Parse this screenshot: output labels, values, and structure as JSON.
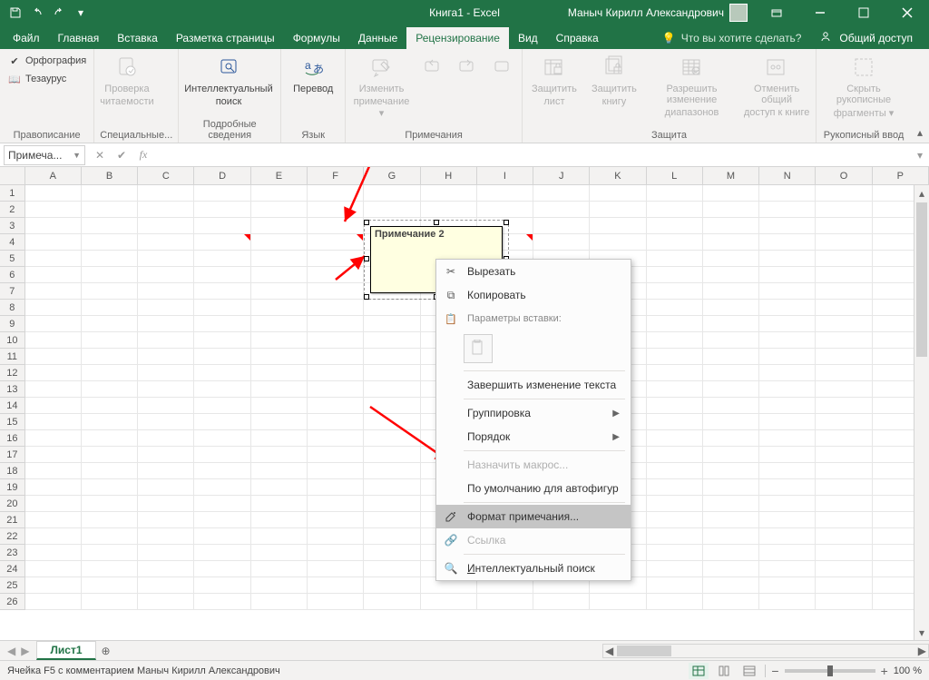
{
  "titlebar": {
    "title": "Книга1  -  Excel",
    "user": "Маныч Кирилл Александрович"
  },
  "tabs": {
    "file": "Файл",
    "home": "Главная",
    "insert": "Вставка",
    "page_layout": "Разметка страницы",
    "formulas": "Формулы",
    "data": "Данные",
    "review": "Рецензирование",
    "view": "Вид",
    "help": "Справка",
    "tellme": "Что вы хотите сделать?",
    "share": "Общий доступ"
  },
  "ribbon": {
    "proofing": {
      "spelling": "Орфография",
      "thesaurus": "Тезаурус",
      "label": "Правописание"
    },
    "accessibility": {
      "btn1": "Проверка",
      "btn2": "читаемости",
      "label": "Специальные..."
    },
    "insights": {
      "btn1": "Интеллектуальный",
      "btn2": "поиск",
      "label": "Подробные сведения"
    },
    "language": {
      "btn": "Перевод",
      "label": "Язык"
    },
    "comments": {
      "edit1": "Изменить",
      "edit2": "примечание",
      "label": "Примечания"
    },
    "protect": {
      "sheet1": "Защитить",
      "sheet2": "лист",
      "book1": "Защитить",
      "book2": "книгу",
      "ranges1": "Разрешить изменение",
      "ranges2": "диапазонов",
      "unshare1": "Отменить общий",
      "unshare2": "доступ к книге",
      "label": "Защита"
    },
    "ink": {
      "hide1": "Скрыть рукописные",
      "hide2": "фрагменты",
      "label": "Рукописный ввод"
    }
  },
  "namebox": {
    "value": "Примеча..."
  },
  "columns": [
    "A",
    "B",
    "C",
    "D",
    "E",
    "F",
    "G",
    "H",
    "I",
    "J",
    "K",
    "L",
    "M",
    "N",
    "O",
    "P"
  ],
  "rows": [
    1,
    2,
    3,
    4,
    5,
    6,
    7,
    8,
    9,
    10,
    11,
    12,
    13,
    14,
    15,
    16,
    17,
    18,
    19,
    20,
    21,
    22,
    23,
    24,
    25,
    26
  ],
  "comment_cells": [
    "D4",
    "F4",
    "I4"
  ],
  "comment": {
    "text": "Примечание 2"
  },
  "context_menu": {
    "cut": "Вырезать",
    "copy": "Копировать",
    "paste_header": "Параметры вставки:",
    "end_edit": "Завершить изменение текста",
    "group": "Группировка",
    "order": "Порядок",
    "assign_macro": "Назначить макрос...",
    "default_shape": "По умолчанию для автофигур",
    "format_comment": "Формат примечания...",
    "link": "Ссылка",
    "smart_lookup": "Интеллектуальный поиск"
  },
  "sheet": {
    "name": "Лист1"
  },
  "status": {
    "text": "Ячейка F5 с комментарием Маныч Кирилл Александрович",
    "zoom": "100 %"
  }
}
